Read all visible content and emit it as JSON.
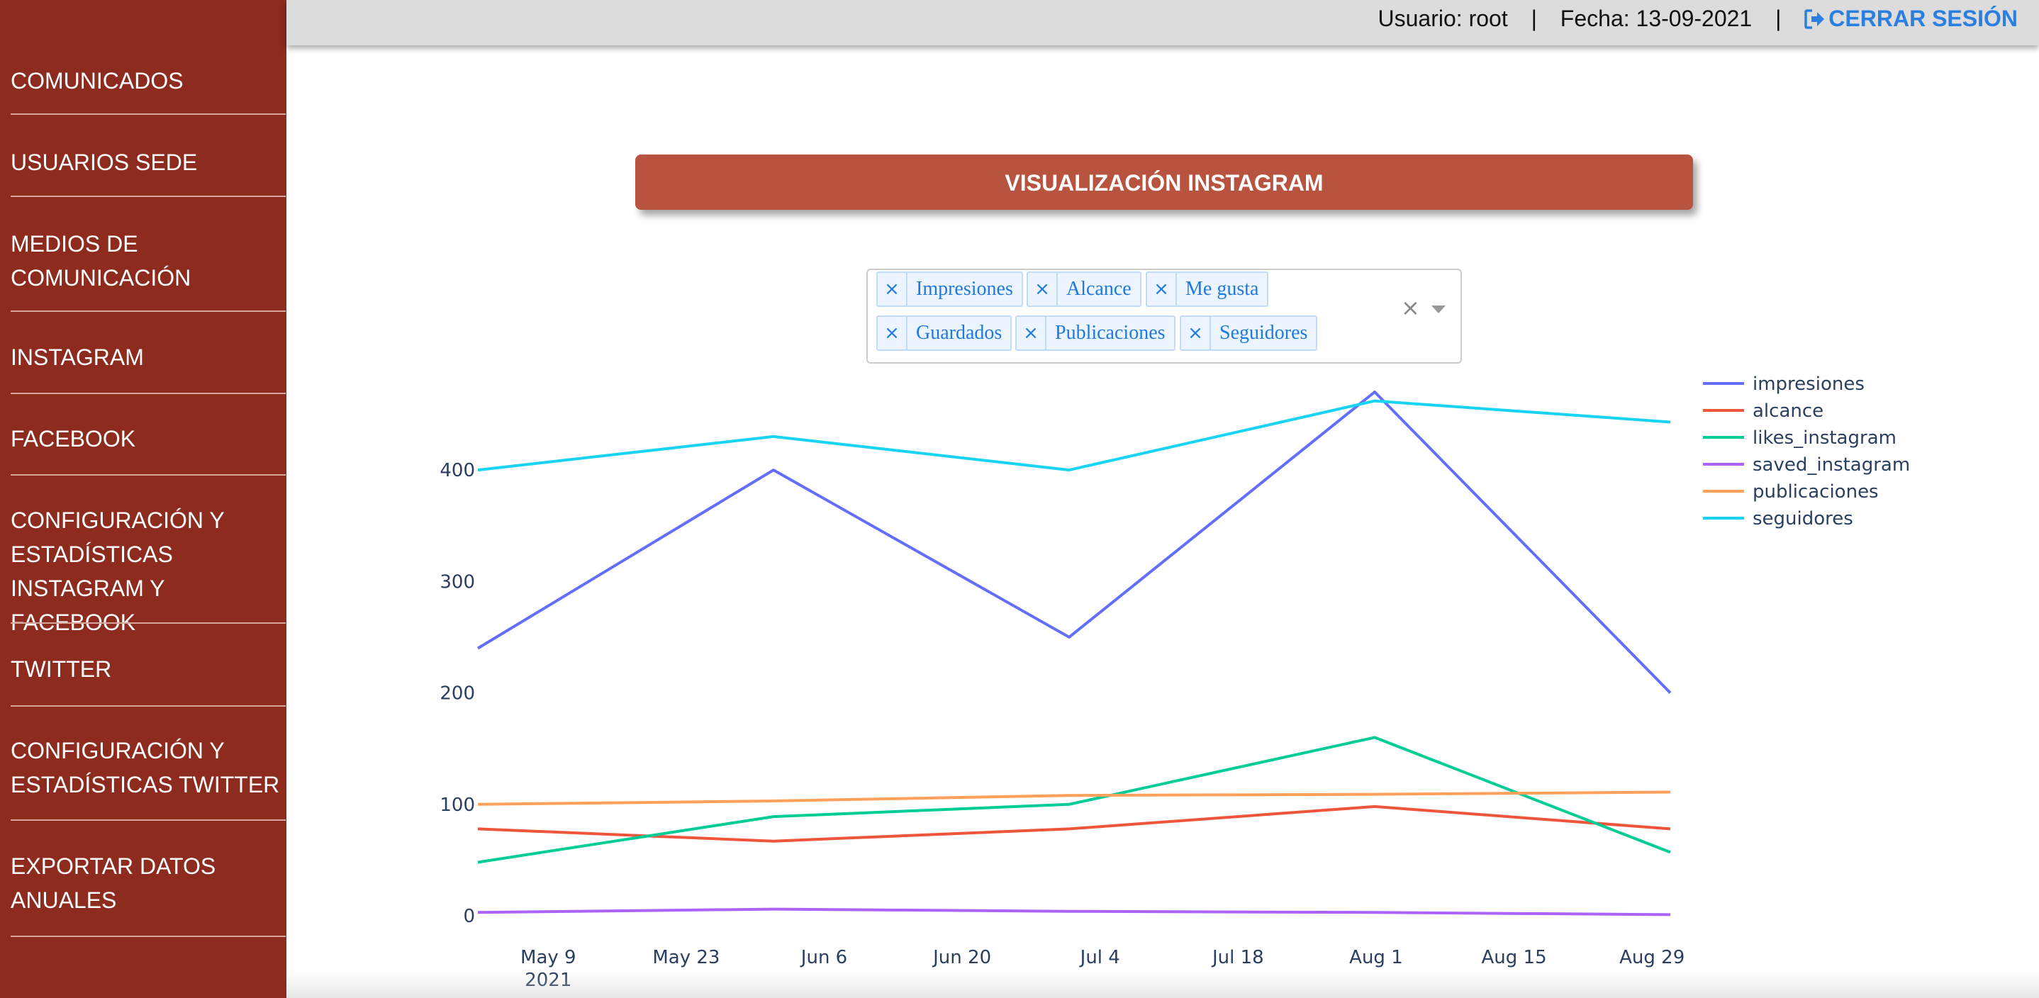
{
  "sidebar": {
    "items": [
      {
        "key": "comunicados",
        "lines": [
          "COMUNICADOS"
        ]
      },
      {
        "key": "usuarios-sede",
        "lines": [
          "USUARIOS SEDE"
        ]
      },
      {
        "key": "medios",
        "lines": [
          "MEDIOS DE",
          "COMUNICACIÓN"
        ]
      },
      {
        "key": "instagram",
        "lines": [
          "INSTAGRAM"
        ]
      },
      {
        "key": "facebook",
        "lines": [
          "FACEBOOK"
        ]
      },
      {
        "key": "config-ig-fb",
        "lines": [
          "CONFIGURACIÓN Y",
          "ESTADÍSTICAS",
          "INSTAGRAM Y FACEBOOK"
        ]
      },
      {
        "key": "twitter",
        "lines": [
          "TWITTER"
        ]
      },
      {
        "key": "config-twitter",
        "lines": [
          "CONFIGURACIÓN Y",
          "ESTADÍSTICAS TWITTER"
        ]
      },
      {
        "key": "exportar",
        "lines": [
          "EXPORTAR DATOS",
          "ANUALES"
        ]
      }
    ]
  },
  "header": {
    "user": "Usuario: root",
    "separator": "|",
    "date": "Fecha: 13-09-2021",
    "logout_label": "CERRAR SESIÓN"
  },
  "main": {
    "title": "VISUALIZACIÓN INSTAGRAM"
  },
  "filter": {
    "tags": [
      "Impresiones",
      "Alcance",
      "Me gusta",
      "Guardados",
      "Publicaciones",
      "Seguidores"
    ],
    "remove_glyph": "×",
    "clear_glyph": "×"
  },
  "chart_data": {
    "type": "line",
    "x": [
      "2021-05-02",
      "2021-06-01",
      "2021-07-01",
      "2021-08-01",
      "2021-08-31"
    ],
    "x_ticks": [
      {
        "date": "2021-05-09",
        "label": "May 9",
        "sublabel": "2021"
      },
      {
        "date": "2021-05-23",
        "label": "May 23"
      },
      {
        "date": "2021-06-06",
        "label": "Jun 6"
      },
      {
        "date": "2021-06-20",
        "label": "Jun 20"
      },
      {
        "date": "2021-07-04",
        "label": "Jul 4"
      },
      {
        "date": "2021-07-18",
        "label": "Jul 18"
      },
      {
        "date": "2021-08-01",
        "label": "Aug 1"
      },
      {
        "date": "2021-08-15",
        "label": "Aug 15"
      },
      {
        "date": "2021-08-29",
        "label": "Aug 29"
      }
    ],
    "y_ticks": [
      0,
      100,
      200,
      300,
      400
    ],
    "xlim": [
      "2021-05-02",
      "2021-08-31"
    ],
    "ylim": [
      0,
      470
    ],
    "legend_position": "top-right",
    "grid": false,
    "series": [
      {
        "name": "impresiones",
        "color": "#636efa",
        "values": [
          240,
          400,
          250,
          470,
          200
        ]
      },
      {
        "name": "alcance",
        "color": "#ef553b",
        "values": [
          78,
          67,
          78,
          98,
          78
        ]
      },
      {
        "name": "likes_instagram",
        "color": "#00cc96",
        "values": [
          48,
          89,
          100,
          160,
          57
        ]
      },
      {
        "name": "saved_instagram",
        "color": "#ab63fa",
        "values": [
          3,
          6,
          4,
          3,
          1
        ]
      },
      {
        "name": "publicaciones",
        "color": "#ffa15a",
        "values": [
          100,
          103,
          108,
          109,
          111
        ]
      },
      {
        "name": "seguidores",
        "color": "#19d3f3",
        "values": [
          400,
          430,
          400,
          462,
          443
        ]
      }
    ]
  },
  "colors": {
    "sidebar_bg": "#8c2b1e",
    "banner_bg": "#b85340",
    "accent_blue": "#2a7fe0"
  }
}
